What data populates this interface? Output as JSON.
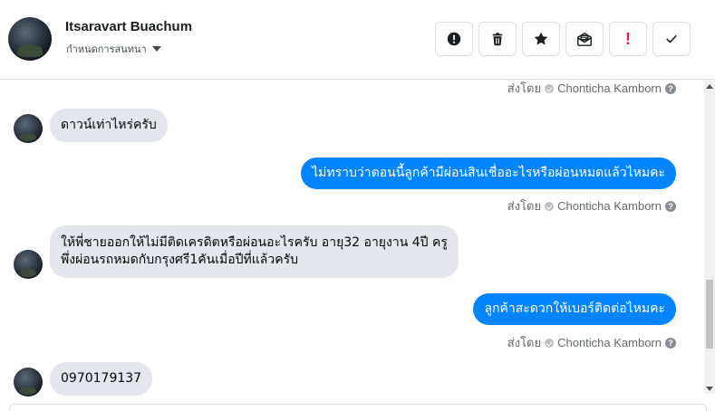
{
  "header": {
    "name": "Itsaravart Buachum",
    "assign_label": "กำหนดการสนทนา",
    "actions": [
      {
        "icon": "alert-circle-icon",
        "name": "mark-spam-button"
      },
      {
        "icon": "trash-icon",
        "name": "delete-button"
      },
      {
        "icon": "star-icon",
        "name": "star-button"
      },
      {
        "icon": "mail-unread-icon",
        "name": "mark-unread-button"
      },
      {
        "icon": "exclamation-icon",
        "name": "follow-up-button",
        "glyph": "!"
      },
      {
        "icon": "checkmark-icon",
        "name": "mark-done-button"
      }
    ]
  },
  "thread": {
    "sent_by_label": "ส่งโดย",
    "agent_name": "Chonticha Kamborn",
    "help_glyph": "?",
    "messages": [
      {
        "direction": "in",
        "text": "ดาวน์เท่าไหร่ครับ"
      },
      {
        "direction": "out",
        "text": "ไม่ทราบว่าตอนนี้ลูกค้ามีผ่อนสินเชื่ออะไรหรือผ่อนหมดแล้วไหมคะ"
      },
      {
        "direction": "in",
        "line1": "ให้พี่ชายออกให้ไม่มีติดเครดิตหรือผ่อนอะไรครับ อายุ32 อายุงาน 4ปี ครู",
        "line2": "พึ่งผ่อนรถหมดกับกรุงศรี1คันเมื่อปีที่แล้วครับ"
      },
      {
        "direction": "out",
        "text": "ลูกค้าสะดวกให้เบอร์ติดต่อไหมคะ"
      },
      {
        "direction": "in",
        "text": "0970179137"
      }
    ]
  },
  "colors": {
    "outgoing_bubble": "#0084ff",
    "incoming_bubble": "#e4e6eb",
    "follow_up_red": "#e41e3f"
  }
}
